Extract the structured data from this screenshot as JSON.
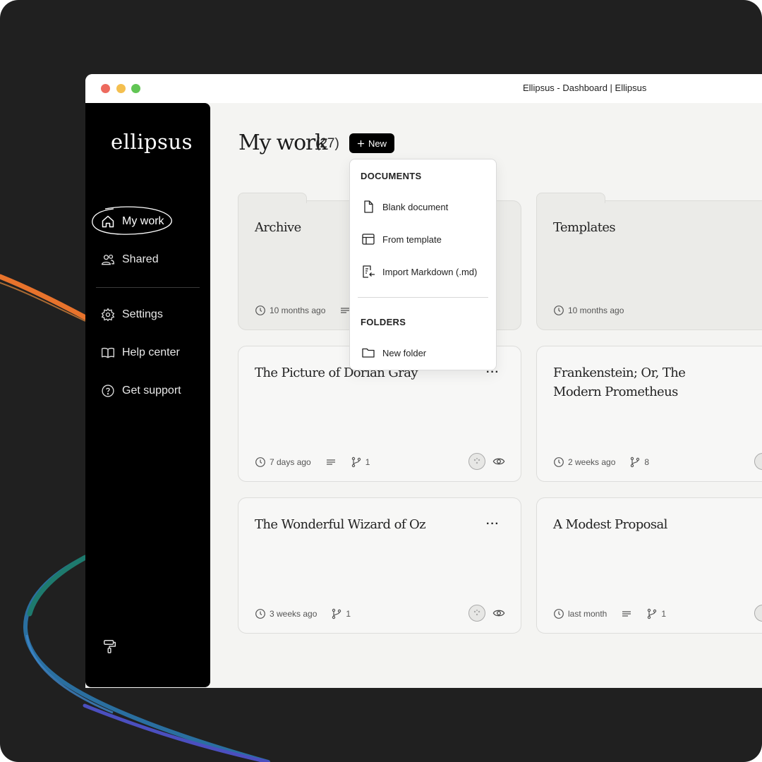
{
  "window": {
    "title": "Ellipsus - Dashboard | Ellipsus",
    "traffic_lights": [
      "#ed6a5e",
      "#f4bf4f",
      "#61c554"
    ]
  },
  "sidebar": {
    "logo": "ellipsus",
    "items": [
      {
        "label": "My work",
        "icon": "home-icon",
        "active": true
      },
      {
        "label": "Shared",
        "icon": "users-icon"
      },
      {
        "label": "Settings",
        "icon": "gear-icon"
      },
      {
        "label": "Help center",
        "icon": "book-icon"
      },
      {
        "label": "Get support",
        "icon": "question-icon"
      }
    ],
    "bottom_icon": "paint-roller-icon"
  },
  "header": {
    "title": "My work",
    "count": "(27)",
    "new_button": "New"
  },
  "dropdown": {
    "documents_heading": "DOCUMENTS",
    "items": [
      "Blank document",
      "From template",
      "Import Markdown (.md)"
    ],
    "folders_heading": "FOLDERS",
    "folder_item": "New folder"
  },
  "cards": [
    {
      "title": "Archive",
      "type": "folder",
      "time": "10 months ago"
    },
    {
      "title": "Templates",
      "type": "folder",
      "time": "10 months ago"
    },
    {
      "title": "The Picture of Dorian Gray",
      "type": "document",
      "time": "7 days ago",
      "branches": "1"
    },
    {
      "title": "Frankenstein; Or, The Modern Prometheus",
      "type": "document",
      "time": "2 weeks ago",
      "branches": "8"
    },
    {
      "title": "The Wonderful Wizard of Oz",
      "type": "document",
      "time": "3 weeks ago",
      "branches": "1"
    },
    {
      "title": "A Modest Proposal",
      "type": "document",
      "time": "last month",
      "branches": "1"
    }
  ],
  "more_label": "···",
  "colors": {
    "background": "#202020",
    "content": "#f4f4f2",
    "sidebar": "#000000",
    "accent_orange": "#e8732c",
    "accent_teal": "#1e7a7a",
    "accent_blue": "#3f6fd0",
    "accent_purple": "#4b4fbf"
  }
}
